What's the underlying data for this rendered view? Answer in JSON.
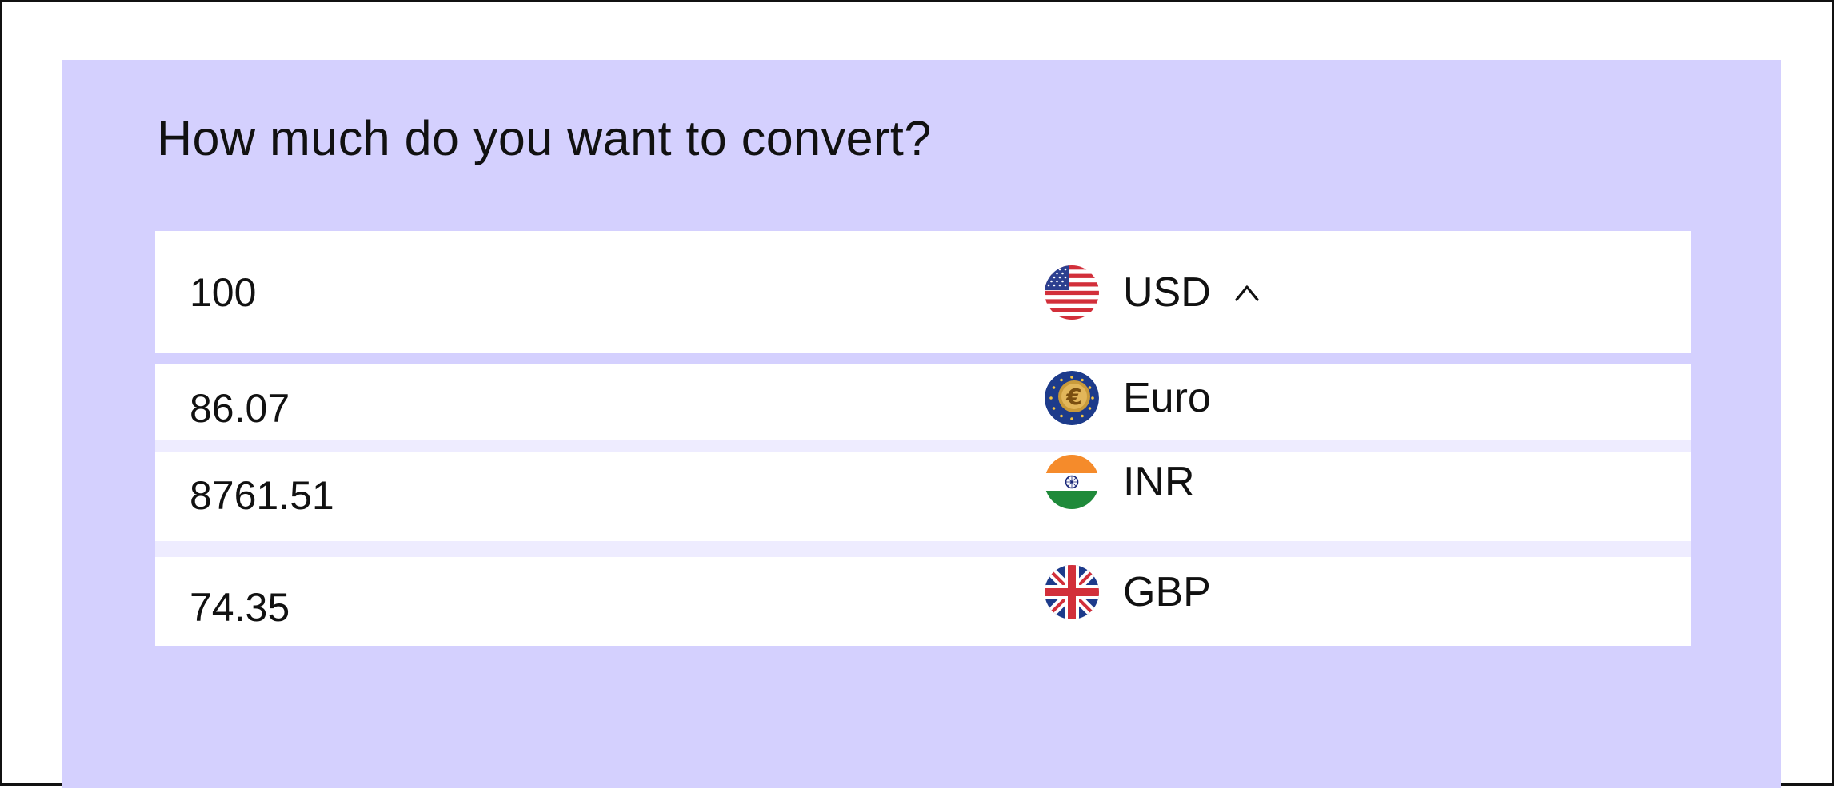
{
  "converter": {
    "question": "How much do you want to convert?",
    "source": {
      "amount": "100",
      "currency_code": "USD",
      "flag_icon": "us-flag-icon",
      "dropdown_state": "open"
    },
    "results": [
      {
        "amount": "86.07",
        "currency_code": "Euro",
        "flag_icon": "eu-euro-icon"
      },
      {
        "amount": "8761.51",
        "currency_code": "INR",
        "flag_icon": "india-flag-icon"
      },
      {
        "amount": "74.35",
        "currency_code": "GBP",
        "flag_icon": "uk-flag-icon"
      }
    ]
  },
  "colors": {
    "panel_background": "#d4d0fe",
    "row_background": "#ffffff",
    "row_gap": "#eeecff",
    "frame_border": "#111111",
    "text": "#111111"
  }
}
